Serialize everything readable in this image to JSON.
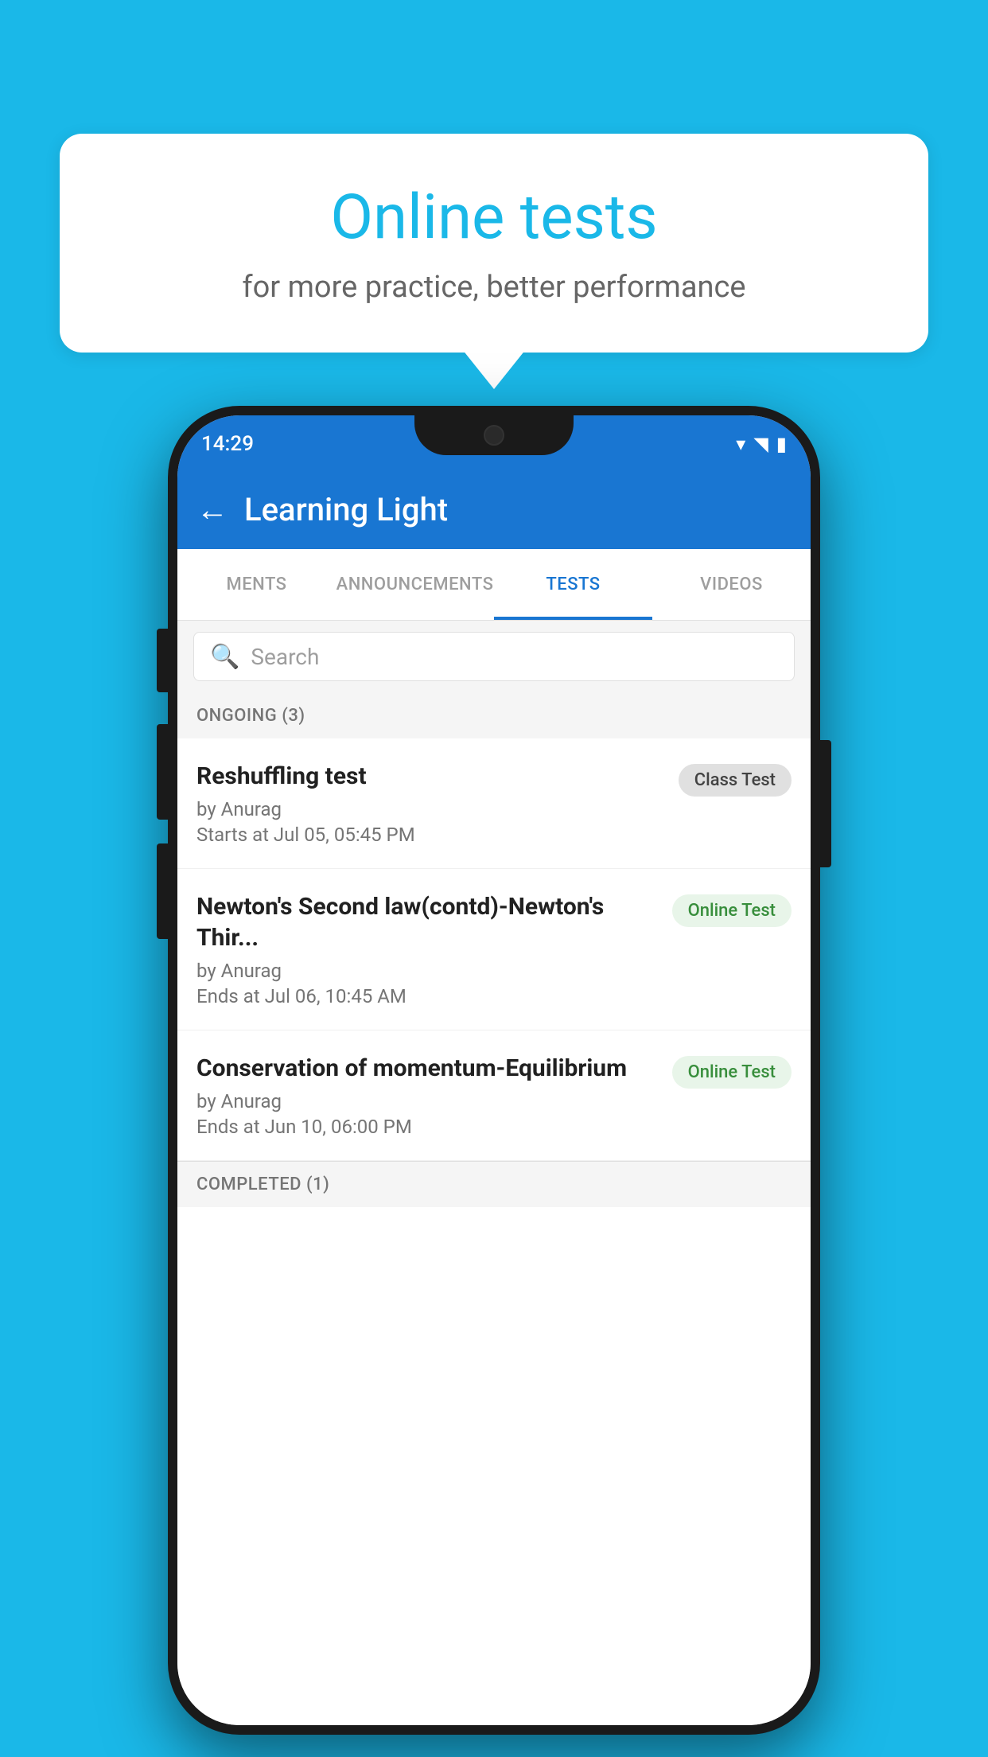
{
  "background_color": "#1ab8e8",
  "speech_bubble": {
    "title": "Online tests",
    "subtitle": "for more practice, better performance"
  },
  "phone": {
    "status_bar": {
      "time": "14:29",
      "icons": [
        "wifi",
        "signal",
        "battery"
      ]
    },
    "app_bar": {
      "back_label": "←",
      "title": "Learning Light"
    },
    "tabs": [
      {
        "label": "MENTS",
        "active": false
      },
      {
        "label": "ANNOUNCEMENTS",
        "active": false
      },
      {
        "label": "TESTS",
        "active": true
      },
      {
        "label": "VIDEOS",
        "active": false
      }
    ],
    "search": {
      "placeholder": "Search"
    },
    "section": {
      "label": "ONGOING (3)"
    },
    "tests": [
      {
        "name": "Reshuffling test",
        "author": "by Anurag",
        "date": "Starts at  Jul 05, 05:45 PM",
        "badge": "Class Test",
        "badge_type": "class"
      },
      {
        "name": "Newton's Second law(contd)-Newton's Thir...",
        "author": "by Anurag",
        "date": "Ends at  Jul 06, 10:45 AM",
        "badge": "Online Test",
        "badge_type": "online"
      },
      {
        "name": "Conservation of momentum-Equilibrium",
        "author": "by Anurag",
        "date": "Ends at  Jun 10, 06:00 PM",
        "badge": "Online Test",
        "badge_type": "online"
      }
    ],
    "completed_section": {
      "label": "COMPLETED (1)"
    }
  }
}
